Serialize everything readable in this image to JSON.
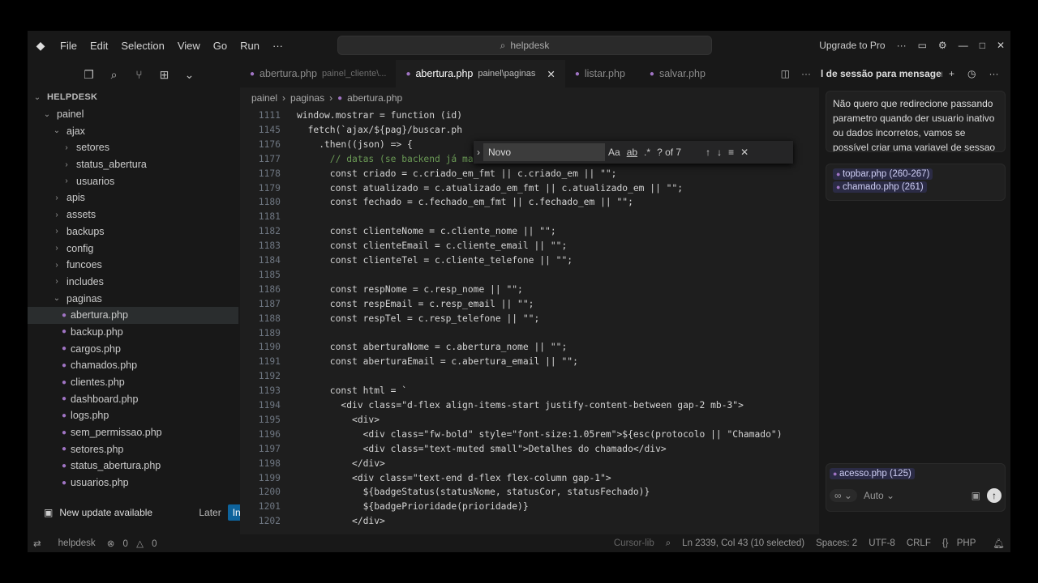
{
  "menu": [
    "File",
    "Edit",
    "Selection",
    "View",
    "Go",
    "Run",
    "···"
  ],
  "search": {
    "text": "helpdesk"
  },
  "upgrade": "Upgrade to Pro",
  "explorer": {
    "title": "HELPDESK",
    "rows": [
      {
        "label": "painel",
        "indent": 1,
        "type": "folder-open"
      },
      {
        "label": "ajax",
        "indent": 2,
        "type": "folder-open"
      },
      {
        "label": "setores",
        "indent": 3,
        "type": "folder"
      },
      {
        "label": "status_abertura",
        "indent": 3,
        "type": "folder"
      },
      {
        "label": "usuarios",
        "indent": 3,
        "type": "folder"
      },
      {
        "label": "apis",
        "indent": 2,
        "type": "folder"
      },
      {
        "label": "assets",
        "indent": 2,
        "type": "folder"
      },
      {
        "label": "backups",
        "indent": 2,
        "type": "folder"
      },
      {
        "label": "config",
        "indent": 2,
        "type": "folder"
      },
      {
        "label": "funcoes",
        "indent": 2,
        "type": "folder"
      },
      {
        "label": "includes",
        "indent": 2,
        "type": "folder"
      },
      {
        "label": "paginas",
        "indent": 2,
        "type": "folder-open"
      },
      {
        "label": "abertura.php",
        "indent": 3,
        "type": "file",
        "selected": true
      },
      {
        "label": "backup.php",
        "indent": 3,
        "type": "file"
      },
      {
        "label": "cargos.php",
        "indent": 3,
        "type": "file"
      },
      {
        "label": "chamados.php",
        "indent": 3,
        "type": "file"
      },
      {
        "label": "clientes.php",
        "indent": 3,
        "type": "file"
      },
      {
        "label": "dashboard.php",
        "indent": 3,
        "type": "file"
      },
      {
        "label": "logs.php",
        "indent": 3,
        "type": "file"
      },
      {
        "label": "sem_permissao.php",
        "indent": 3,
        "type": "file"
      },
      {
        "label": "setores.php",
        "indent": 3,
        "type": "file"
      },
      {
        "label": "status_abertura.php",
        "indent": 3,
        "type": "file"
      },
      {
        "label": "usuarios.php",
        "indent": 3,
        "type": "file"
      }
    ]
  },
  "update": {
    "text": "New update available",
    "later": "Later",
    "install": "Install Now"
  },
  "tabs": [
    {
      "name": "abertura.php",
      "desc": "painel_cliente\\...",
      "active": false
    },
    {
      "name": "abertura.php",
      "desc": "painel\\paginas",
      "active": true
    },
    {
      "name": "listar.php",
      "desc": "",
      "active": false
    },
    {
      "name": "salvar.php",
      "desc": "",
      "active": false
    }
  ],
  "breadcrumb": [
    "painel",
    "paginas",
    "abertura.php"
  ],
  "find": {
    "value": "Novo",
    "count": "? of 7",
    "case": "Aa",
    "word": "ab",
    "regex": ".*"
  },
  "code_lines": [
    {
      "n": "1111",
      "t": "window.mostrar = function (id)"
    },
    {
      "n": "1145",
      "t": "  fetch(`ajax/${pag}/buscar.ph"
    },
    {
      "n": "1176",
      "t": "    .then((json) => {"
    },
    {
      "n": "1177",
      "t": "      // datas (se backend já mandar formatado, melhor)"
    },
    {
      "n": "1178",
      "t": "      const criado = c.criado_em_fmt || c.criado_em || \"\";"
    },
    {
      "n": "1179",
      "t": "      const atualizado = c.atualizado_em_fmt || c.atualizado_em || \"\";"
    },
    {
      "n": "1180",
      "t": "      const fechado = c.fechado_em_fmt || c.fechado_em || \"\";"
    },
    {
      "n": "1181",
      "t": ""
    },
    {
      "n": "1182",
      "t": "      const clienteNome = c.cliente_nome || \"\";"
    },
    {
      "n": "1183",
      "t": "      const clienteEmail = c.cliente_email || \"\";"
    },
    {
      "n": "1184",
      "t": "      const clienteTel = c.cliente_telefone || \"\";"
    },
    {
      "n": "1185",
      "t": ""
    },
    {
      "n": "1186",
      "t": "      const respNome = c.resp_nome || \"\";"
    },
    {
      "n": "1187",
      "t": "      const respEmail = c.resp_email || \"\";"
    },
    {
      "n": "1188",
      "t": "      const respTel = c.resp_telefone || \"\";"
    },
    {
      "n": "1189",
      "t": ""
    },
    {
      "n": "1190",
      "t": "      const aberturaNome = c.abertura_nome || \"\";"
    },
    {
      "n": "1191",
      "t": "      const aberturaEmail = c.abertura_email || \"\";"
    },
    {
      "n": "1192",
      "t": ""
    },
    {
      "n": "1193",
      "t": "      const html = `"
    },
    {
      "n": "1194",
      "t": "        <div class=\"d-flex align-items-start justify-content-between gap-2 mb-3\">"
    },
    {
      "n": "1195",
      "t": "          <div>"
    },
    {
      "n": "1196",
      "t": "            <div class=\"fw-bold\" style=\"font-size:1.05rem\">${esc(protocolo || \"Chamado\")"
    },
    {
      "n": "1197",
      "t": "            <div class=\"text-muted small\">Detalhes do chamado</div>"
    },
    {
      "n": "1198",
      "t": "          </div>"
    },
    {
      "n": "1199",
      "t": "          <div class=\"text-end d-flex flex-column gap-1\">"
    },
    {
      "n": "1200",
      "t": "            ${badgeStatus(statusNome, statusCor, statusFechado)}"
    },
    {
      "n": "1201",
      "t": "            ${badgePrioridade(prioridade)}"
    },
    {
      "n": "1202",
      "t": "          </div>"
    }
  ],
  "chat": {
    "title": "l de sessão para mensagen:",
    "message": "Não quero que redirecione passando parametro quando der usuario inativo ou dados incorretos, vamos se possível criar uma variavel de sessao",
    "context": [
      "topbar.php (260-267)",
      "chamado.php (261)"
    ],
    "attach": "acesso.php (125)",
    "mode": "∞",
    "model": "Auto"
  },
  "status": {
    "branch": "helpdesk",
    "errors": "0",
    "warnings": "0",
    "cursor": "Ln 2339, Col 43 (10 selected)",
    "spaces": "Spaces: 2",
    "encoding": "UTF-8",
    "eol": "CRLF",
    "lang": "PHP",
    "cursorlib": "Cursor-lib"
  }
}
